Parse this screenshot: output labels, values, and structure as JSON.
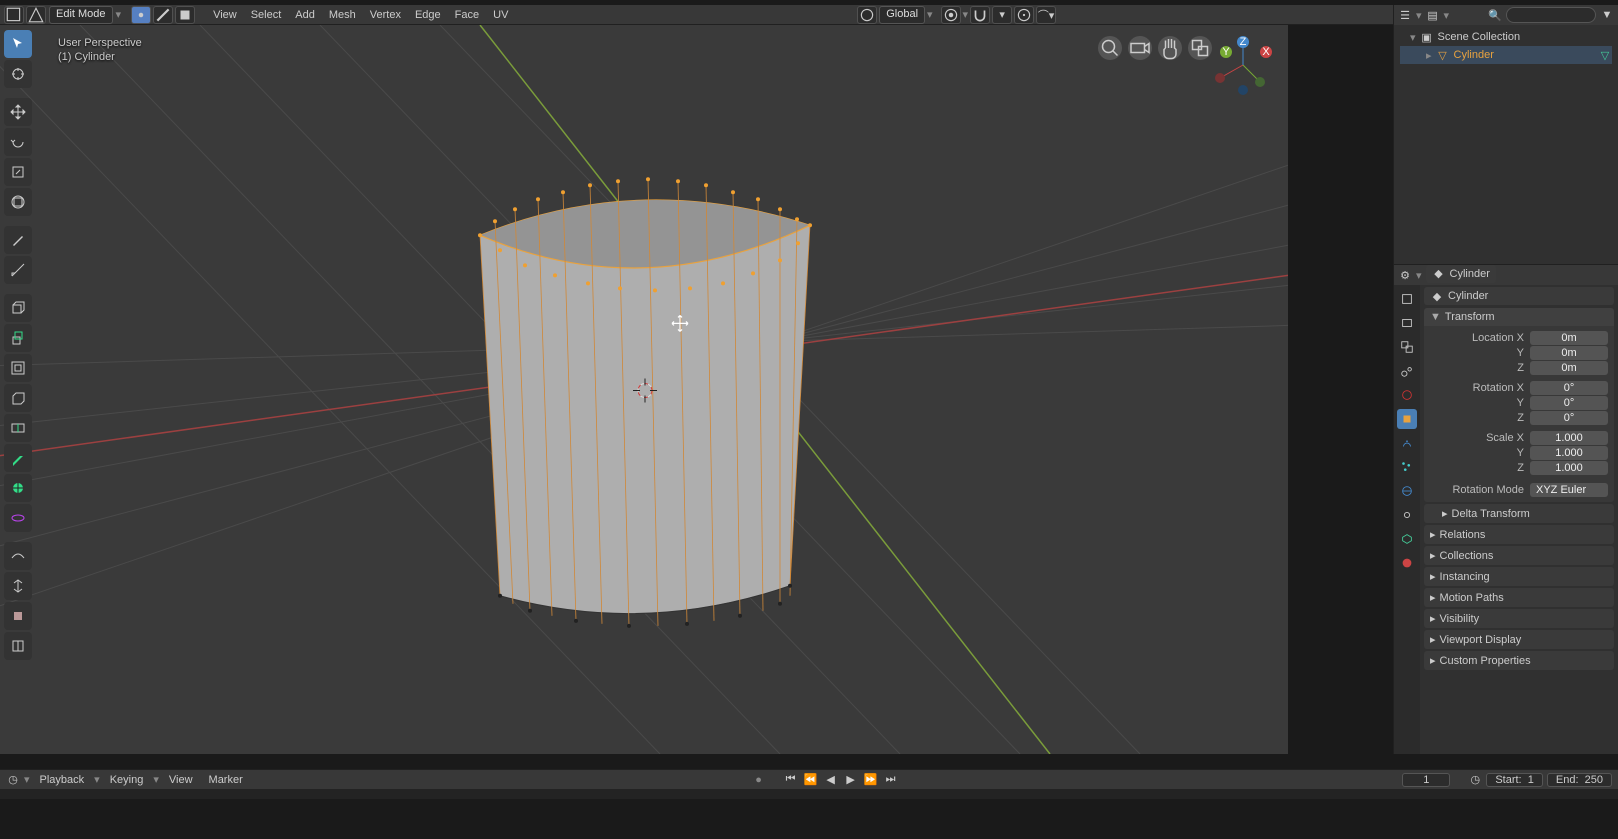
{
  "header": {
    "mode_label": "Edit Mode",
    "orientation": "Global",
    "menus": [
      "View",
      "Select",
      "Add",
      "Mesh",
      "Vertex",
      "Edge",
      "Face",
      "UV"
    ]
  },
  "overlay": {
    "perspective": "User Perspective",
    "object_info": "(1) Cylinder"
  },
  "outliner": {
    "root": "Scene Collection",
    "item": "Cylinder"
  },
  "props": {
    "object_name": "Cylinder",
    "data_name": "Cylinder",
    "transform_label": "Transform",
    "rows": {
      "loc_x_label": "Location X",
      "loc_x": "0m",
      "loc_y_label": "Y",
      "loc_y": "0m",
      "loc_z_label": "Z",
      "loc_z": "0m",
      "rot_x_label": "Rotation X",
      "rot_x": "0°",
      "rot_y_label": "Y",
      "rot_y": "0°",
      "rot_z_label": "Z",
      "rot_z": "0°",
      "scl_x_label": "Scale X",
      "scl_x": "1.000",
      "scl_y_label": "Y",
      "scl_y": "1.000",
      "scl_z_label": "Z",
      "scl_z": "1.000",
      "rotmode_label": "Rotation Mode",
      "rotmode": "XYZ Euler"
    },
    "panels": {
      "delta_transform": "Delta Transform",
      "relations": "Relations",
      "collections": "Collections",
      "instancing": "Instancing",
      "motion_paths": "Motion Paths",
      "visibility": "Visibility",
      "viewport_display": "Viewport Display",
      "custom_properties": "Custom Properties"
    }
  },
  "timeline": {
    "menus": {
      "playback": "Playback",
      "keying": "Keying",
      "view": "View",
      "marker": "Marker"
    },
    "current": "1",
    "start_label": "Start:",
    "start": "1",
    "end_label": "End:",
    "end": "250"
  },
  "icons": {
    "cursor": "cursor",
    "vertex": "vertex",
    "edge": "edge",
    "face": "face"
  }
}
